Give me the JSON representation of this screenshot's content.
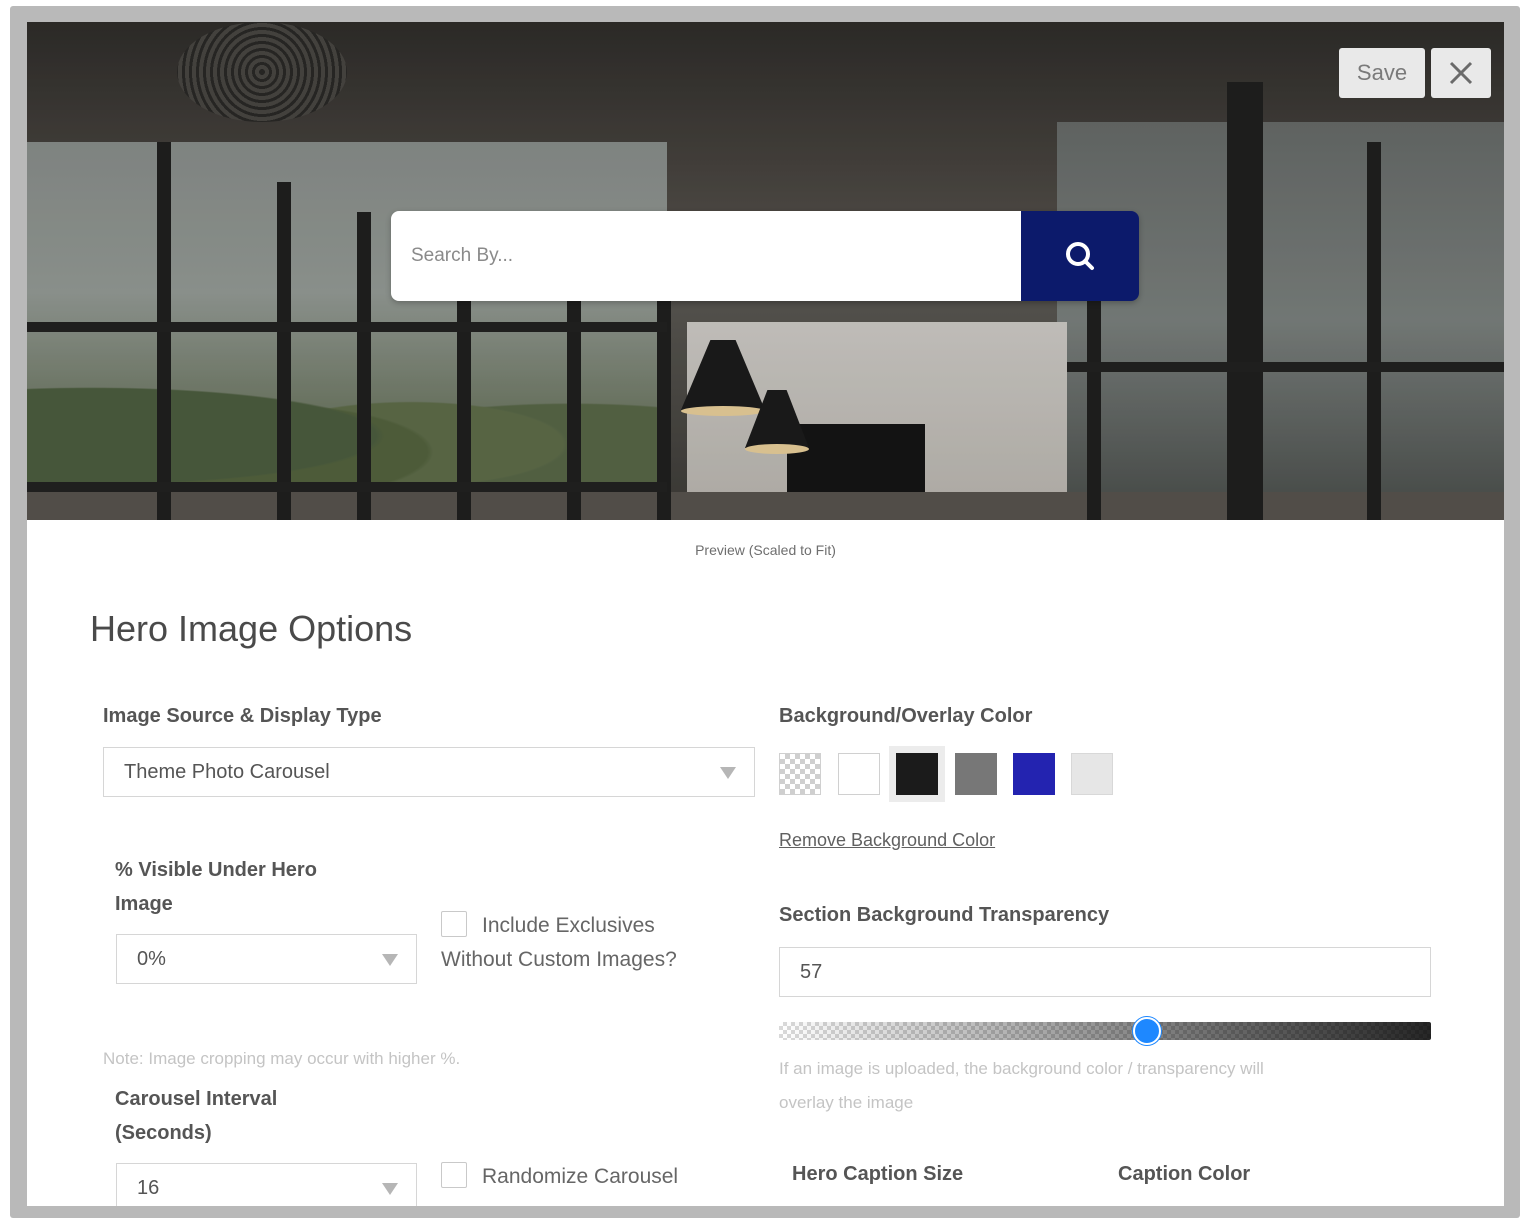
{
  "toolbar": {
    "save_label": "Save"
  },
  "hero": {
    "search_placeholder": "Search By..."
  },
  "preview_caption": "Preview (Scaled to Fit)",
  "section_title": "Hero Image Options",
  "image_source": {
    "label": "Image Source & Display Type",
    "selected": "Theme Photo Carousel"
  },
  "visible_under_hero": {
    "label_line1": "% Visible Under Hero",
    "label_line2": "Image",
    "selected": "0%",
    "note": "Note: Image cropping may occur with higher %."
  },
  "include_exclusives": {
    "label_line1": "Include Exclusives",
    "label_line2": "Without Custom Images?",
    "checked": false
  },
  "carousel_interval": {
    "label_line1": "Carousel Interval",
    "label_line2": "(Seconds)",
    "selected": "16"
  },
  "randomize_carousel": {
    "label": "Randomize Carousel",
    "checked": false
  },
  "background_color": {
    "label": "Background/Overlay Color",
    "swatches": [
      {
        "name": "transparent",
        "color": "transparent"
      },
      {
        "name": "white",
        "color": "#ffffff"
      },
      {
        "name": "black",
        "color": "#1b1b1b",
        "selected": true
      },
      {
        "name": "gray",
        "color": "#777777"
      },
      {
        "name": "blue",
        "color": "#2323b0"
      },
      {
        "name": "light-gray",
        "color": "#e6e6e6"
      }
    ],
    "remove_label": "Remove Background Color"
  },
  "transparency": {
    "label": "Section Background Transparency",
    "value": "57",
    "slider_fraction": 0.565,
    "note_line1": "If an image is uploaded, the background color / transparency will",
    "note_line2": "overlay the image"
  },
  "hero_caption_size": {
    "label": "Hero Caption Size"
  },
  "caption_color": {
    "label": "Caption Color"
  },
  "colors": {
    "search_button": "#0c1a6b",
    "slider_thumb": "#1e88ff"
  }
}
